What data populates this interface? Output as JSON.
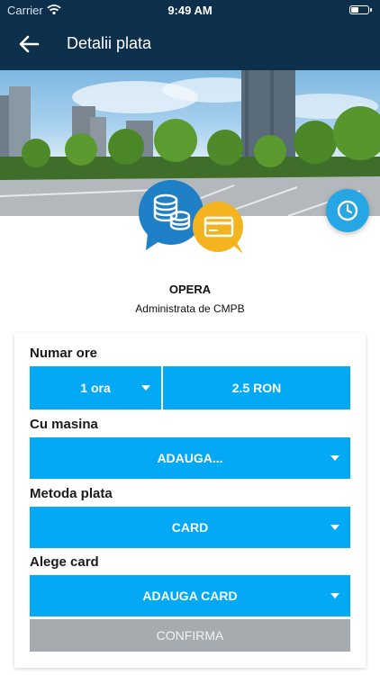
{
  "status_bar": {
    "carrier": "Carrier",
    "time": "9:49 AM",
    "battery_level": 0.4
  },
  "header": {
    "title": "Detalii plata"
  },
  "location": {
    "name": "OPERA",
    "admin": "Administrata de CMPB"
  },
  "form": {
    "hours_label": "Numar ore",
    "hours_value": "1 ora",
    "price": "2.5 RON",
    "car_label": "Cu masina",
    "car_value": "ADAUGA...",
    "payment_label": "Metoda plata",
    "payment_value": "CARD",
    "card_label": "Alege card",
    "card_value": "ADAUGA CARD",
    "confirm_label": "CONFIRMA"
  },
  "colors": {
    "header_bg": "#0c2f4c",
    "accent": "#03a9f4",
    "fab": "#27a6e6",
    "disabled": "#a6abb0",
    "coin_bubble": "#1f7fc7",
    "card_bubble": "#f4b41f"
  },
  "icons": [
    "wifi-icon",
    "battery-icon",
    "back-arrow-icon",
    "clock-icon",
    "coins-icon",
    "credit-card-icon",
    "chevron-down-icon"
  ]
}
